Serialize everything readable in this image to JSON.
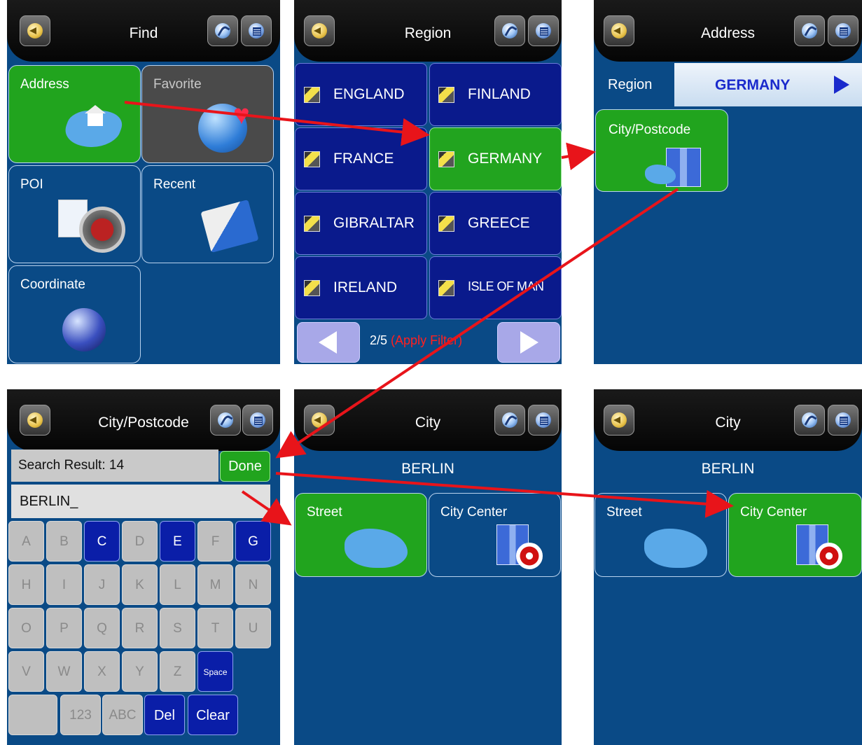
{
  "screens": {
    "find": {
      "title": "Find",
      "tiles": [
        "Address",
        "Favorite",
        "POI",
        "Recent",
        "Coordinate"
      ]
    },
    "region": {
      "title": "Region",
      "items": [
        "ENGLAND",
        "FINLAND",
        "FRANCE",
        "GERMANY",
        "GIBRALTAR",
        "GREECE",
        "IRELAND",
        "ISLE OF MAN"
      ],
      "page": "2/5",
      "filter": "(Apply Filter)"
    },
    "address": {
      "title": "Address",
      "region_label": "Region",
      "region_value": "GERMANY",
      "city_button": "City/Postcode"
    },
    "city_postcode": {
      "title": "City/Postcode",
      "result": "Search Result: 14",
      "done": "Done",
      "input_value": "BERLIN_",
      "keys": [
        "A",
        "B",
        "C",
        "D",
        "E",
        "F",
        "G",
        "H",
        "I",
        "J",
        "K",
        "L",
        "M",
        "N",
        "O",
        "P",
        "Q",
        "R",
        "S",
        "T",
        "U",
        "V",
        "W",
        "X",
        "Y",
        "Z",
        "Space"
      ],
      "bottom_keys": [
        "123",
        "ABC",
        "Del",
        "Clear"
      ]
    },
    "city_a": {
      "title": "City",
      "city": "BERLIN",
      "street": "Street",
      "center": "City Center"
    },
    "city_b": {
      "title": "City",
      "city": "BERLIN",
      "street": "Street",
      "center": "City Center"
    }
  },
  "colors": {
    "panel_bg": "#0a4a86",
    "selected_green": "#21a41e",
    "key_active": "#0a1ea8",
    "arrow": "#e8141a"
  }
}
